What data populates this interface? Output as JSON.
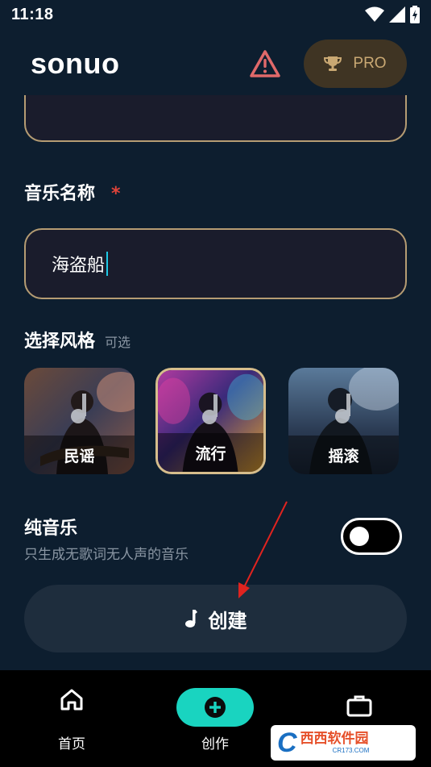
{
  "status_bar": {
    "time": "11:18"
  },
  "header": {
    "app_name": "sonuo",
    "pro_label": "PRO"
  },
  "music_name": {
    "label": "音乐名称",
    "required_mark": "*",
    "value": "海盗船"
  },
  "style_section": {
    "label": "选择风格",
    "hint": "可选",
    "options": [
      {
        "label": "民谣",
        "selected": false
      },
      {
        "label": "流行",
        "selected": true
      },
      {
        "label": "摇滚",
        "selected": false
      }
    ]
  },
  "instrumental": {
    "title": "纯音乐",
    "description": "只生成无歌词无人声的音乐",
    "enabled": false
  },
  "create_button": {
    "label": "创建"
  },
  "bottom_nav": [
    {
      "label": "首页",
      "icon": "home-icon"
    },
    {
      "label": "创作",
      "icon": "plus-circle-icon",
      "active": true
    },
    {
      "label": "",
      "icon": "briefcase-icon"
    }
  ],
  "watermark": {
    "main": "西西软件园",
    "sub": "CR173.COM"
  },
  "colors": {
    "background": "#0d1e2f",
    "accent_gold": "#b59c73",
    "accent_teal": "#19d4c0",
    "required_red": "#e0443a",
    "warning_red": "#e0696a"
  }
}
